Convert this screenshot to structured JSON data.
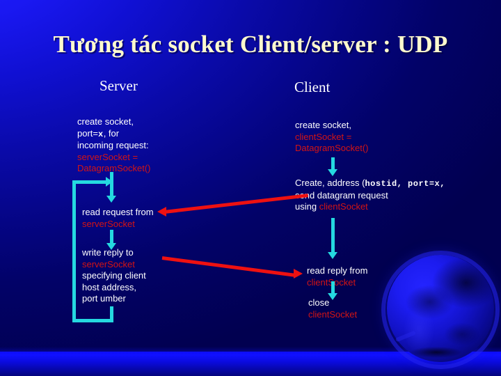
{
  "slide": {
    "title": "Tương tác socket Client/server : UDP",
    "background_color": "#00007a",
    "title_color": "#fffacd",
    "code_color": "#d41414",
    "text_color": "#ffffff",
    "connector_color": "#25d9e0",
    "message_arrow_color": "#ee1111"
  },
  "columns": {
    "server_heading": "Server",
    "client_heading": "Client"
  },
  "server": {
    "create": {
      "line1": "create socket,",
      "line2_pre": "port=",
      "line2_mono": "x",
      "line2_post": ", for",
      "line3": "incoming request:",
      "code1": "serverSocket =",
      "code2": "DatagramSocket()"
    },
    "read": {
      "line1": "read request from",
      "code1": "serverSocket"
    },
    "write": {
      "line1": "write reply to",
      "code1": "serverSocket",
      "line2": "specifying client",
      "line3": "host address,",
      "line4": "port umber"
    }
  },
  "client": {
    "create": {
      "line1": "create socket,",
      "code1": "clientSocket =",
      "code2": "DatagramSocket()"
    },
    "send": {
      "line1_pre": "Create, address (",
      "line1_mono": "hostid, port=x,",
      "line2": "send datagram request",
      "line3_pre": "using ",
      "line3_code": "clientSocket"
    },
    "read": {
      "line1": "read reply from",
      "code1": "clientSocket"
    },
    "close": {
      "line1": "close",
      "code1": "clientSocket"
    }
  }
}
